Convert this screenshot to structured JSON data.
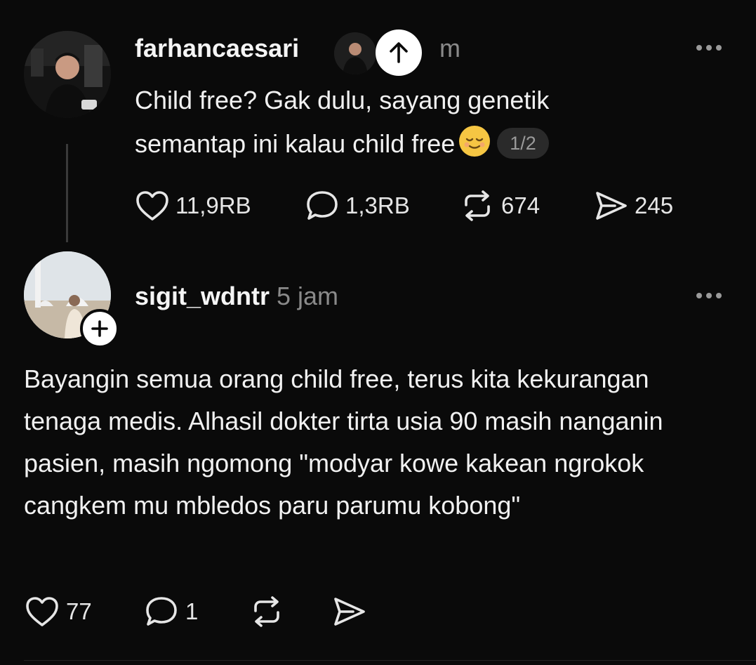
{
  "post": {
    "username": "farhancaesari",
    "time_fragment": "m",
    "text_line1": "Child free? Gak dulu, sayang genetik",
    "text_line2": "semantap ini kalau child free",
    "page_indicator": "1/2",
    "likes": "11,9RB",
    "comments": "1,3RB",
    "reposts": "674",
    "shares": "245",
    "more_icon": "more-horizontal-icon"
  },
  "reply": {
    "username": "sigit_wdntr",
    "time": "5 jam",
    "text": "Bayangin semua orang child free, terus kita kekurangan tenaga medis. Alhasil dokter tirta usia 90 masih nanganin pasien, masih ngomong \"modyar kowe kakean ngrokok cangkem mu mbledos paru parumu kobong\"",
    "likes": "77",
    "comments": "1"
  },
  "icons": {
    "like": "heart-icon",
    "comment": "comment-bubble-icon",
    "repost": "repost-icon",
    "share": "send-icon",
    "scroll_up": "arrow-up-icon",
    "follow": "plus-icon"
  },
  "colors": {
    "background": "#0a0a0a",
    "text": "#f1f1f1",
    "muted": "#8a8a8a"
  }
}
